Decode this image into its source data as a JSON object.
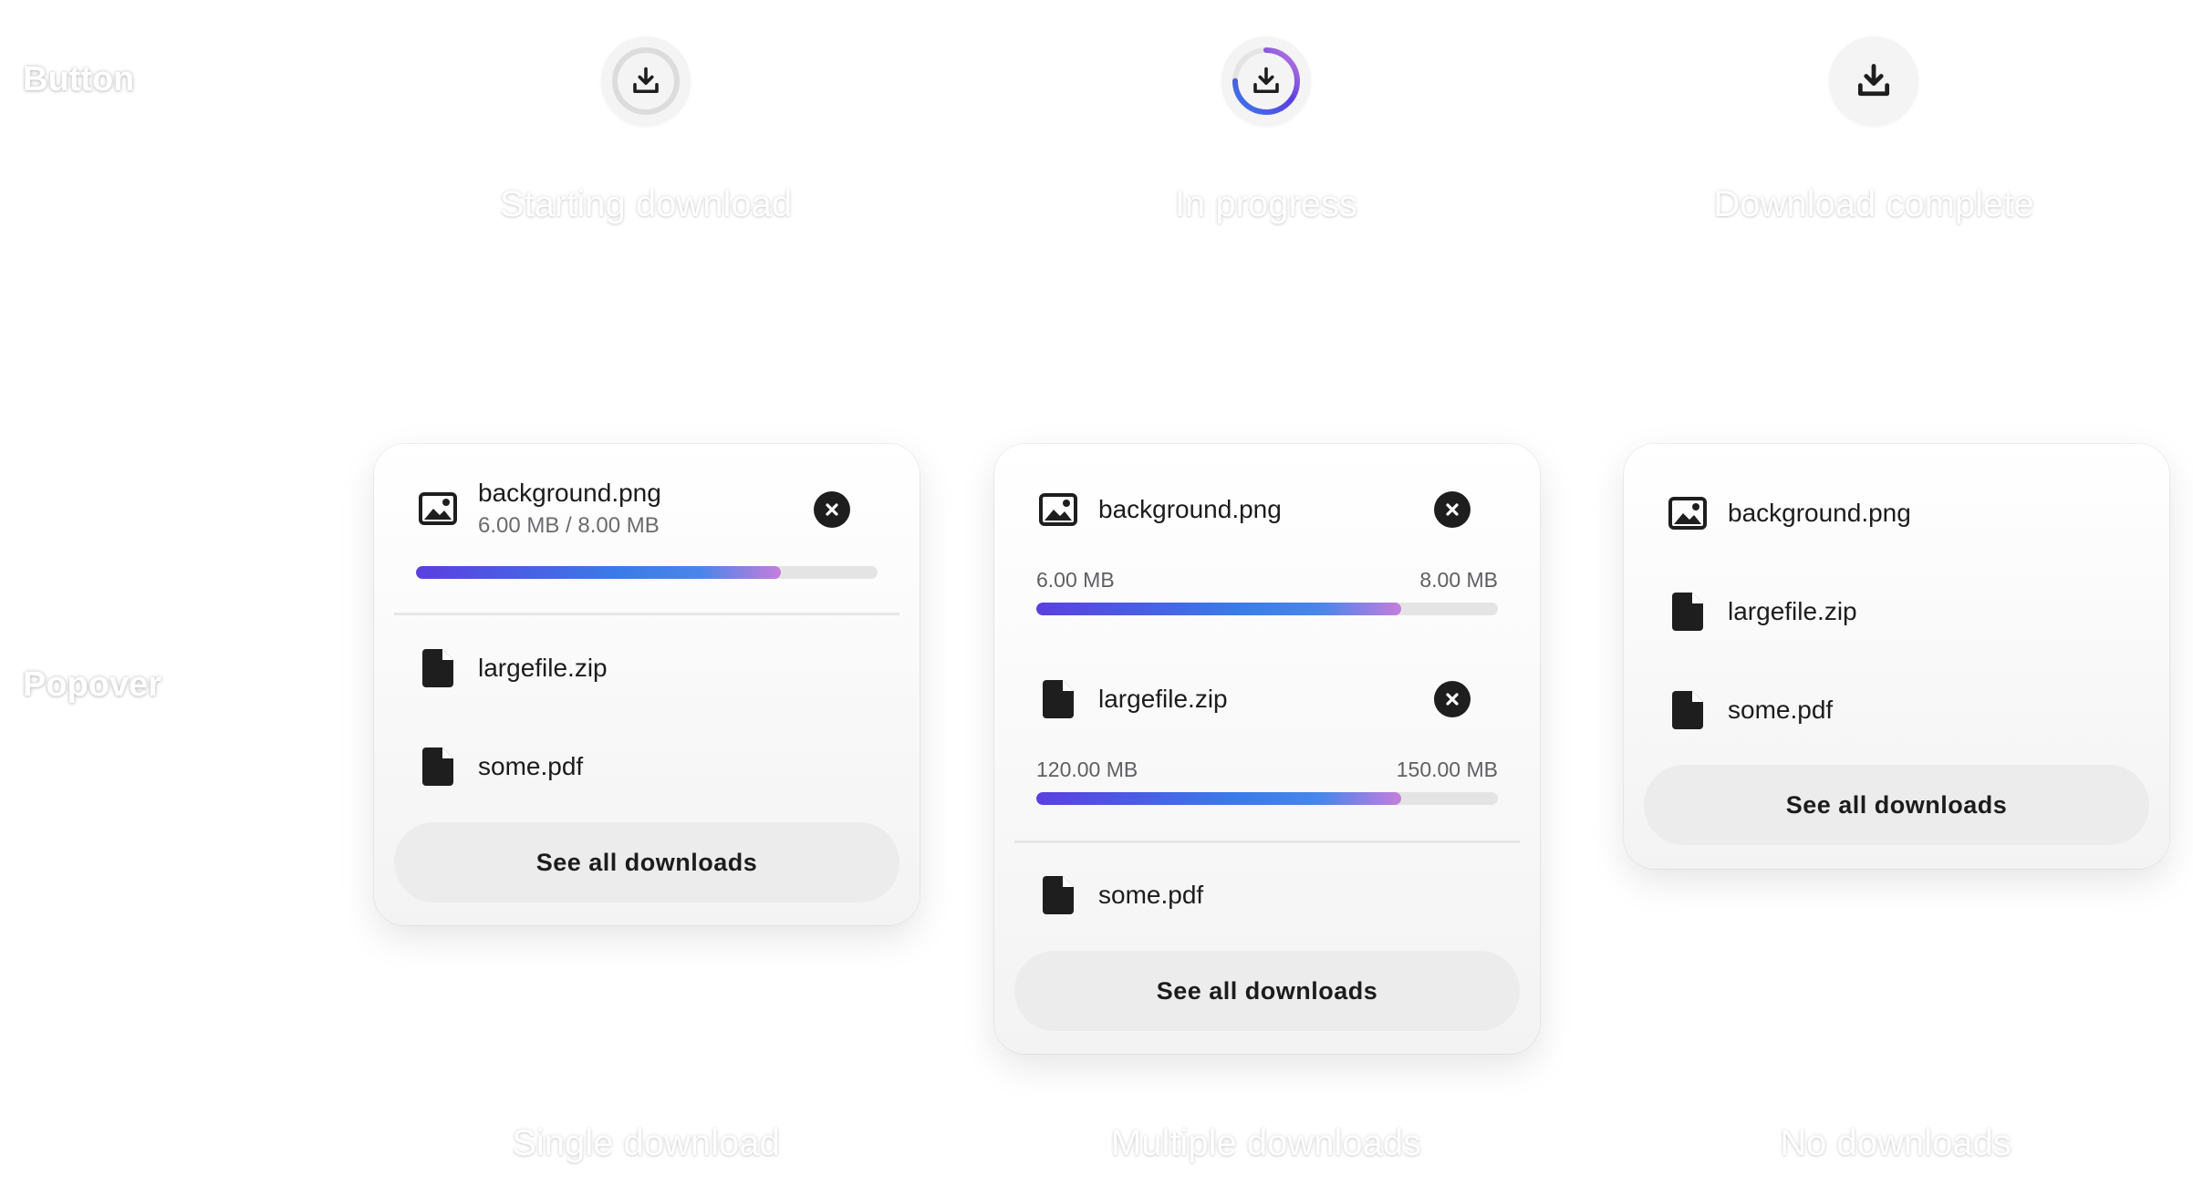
{
  "labels": {
    "button_row": "Button",
    "popover_row": "Popover"
  },
  "button_states": [
    {
      "caption": "Starting download",
      "icon": "download-icon"
    },
    {
      "caption": "In progress",
      "icon": "download-icon",
      "progress": 0.75
    },
    {
      "caption": "Download complete",
      "icon": "download-icon"
    }
  ],
  "popovers": {
    "single": {
      "caption": "Single download",
      "active": {
        "name": "background.png",
        "size_text": "6.00 MB / 8.00 MB",
        "progress": 0.79,
        "icon": "image-icon"
      },
      "files": [
        {
          "name": "largefile.zip",
          "icon": "file-icon"
        },
        {
          "name": "some.pdf",
          "icon": "file-icon"
        }
      ],
      "see_all": "See all downloads"
    },
    "multiple": {
      "caption": "Multiple downloads",
      "active": [
        {
          "name": "background.png",
          "current": "6.00 MB",
          "total": "8.00 MB",
          "progress": 0.79,
          "icon": "image-icon"
        },
        {
          "name": "largefile.zip",
          "current": "120.00 MB",
          "total": "150.00 MB",
          "progress": 0.79,
          "icon": "file-icon"
        }
      ],
      "files": [
        {
          "name": "some.pdf",
          "icon": "file-icon"
        }
      ],
      "see_all": "See all downloads"
    },
    "none": {
      "caption": "No downloads",
      "files": [
        {
          "name": "background.png",
          "icon": "image-icon"
        },
        {
          "name": "largefile.zip",
          "icon": "file-icon"
        },
        {
          "name": "some.pdf",
          "icon": "file-icon"
        }
      ],
      "see_all": "See all downloads"
    }
  },
  "colors": {
    "progress_start": "#5b3fe0",
    "progress_mid": "#3a7be8",
    "progress_end": "#c57ddc",
    "track": "#e4e4e4"
  }
}
